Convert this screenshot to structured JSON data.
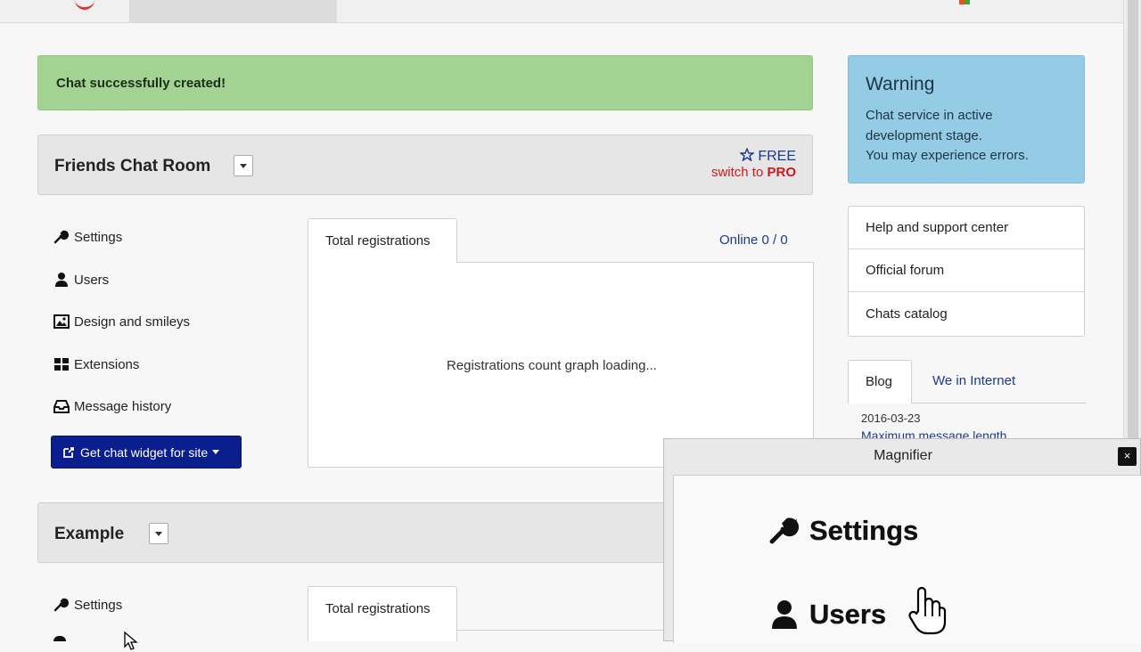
{
  "alerts": {
    "success": "Chat successfully created!",
    "warning": {
      "title": "Warning",
      "lines": [
        "Chat service in active",
        "development stage.",
        "You may experience errors."
      ]
    }
  },
  "chats": [
    {
      "name": "Friends Chat Room",
      "plan": "FREE",
      "switch_prefix": "switch to ",
      "switch_plan": "PRO",
      "menu": [
        "Settings",
        "Users",
        "Design and smileys",
        "Extensions",
        "Message history"
      ],
      "widget_button": "Get chat widget for site",
      "tab": "Total registrations",
      "online": "Online 0 / 0",
      "loading": "Registrations count graph loading..."
    },
    {
      "name": "Example",
      "menu": [
        "Settings"
      ],
      "tab": "Total registrations"
    }
  ],
  "sidebar": {
    "links": [
      "Help and support center",
      "Official forum",
      "Chats catalog"
    ],
    "tabs": [
      "Blog",
      "We in Internet"
    ],
    "blog": {
      "date": "2016-03-23",
      "title": "Maximum message length"
    }
  },
  "magnifier": {
    "title": "Magnifier",
    "close": "×",
    "zoom_items": [
      "Settings",
      "Users"
    ]
  },
  "icons": {
    "settings": "wrench-icon",
    "users": "user-icon",
    "design": "image-icon",
    "extensions": "grid-icon",
    "history": "inbox-icon",
    "widget": "external-link-icon",
    "plan": "star-icon"
  },
  "colors": {
    "success_bg": "#a3d393",
    "info_bg": "#94cbe5",
    "primary_btn": "#0b1e8e",
    "link": "#1a3b8c",
    "pro": "#cc1a1a"
  }
}
